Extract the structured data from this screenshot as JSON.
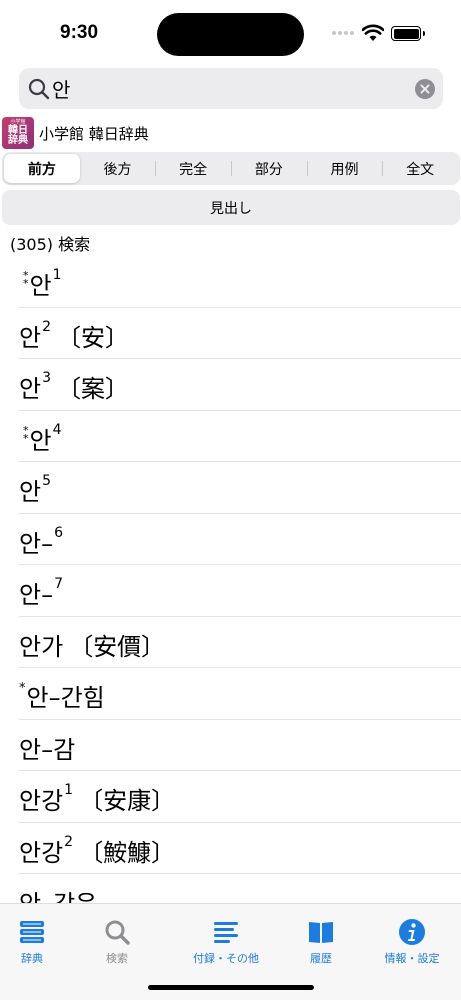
{
  "status_bar": {
    "time": "9:30"
  },
  "search": {
    "value": "안"
  },
  "dictionary": {
    "logo_lines": [
      "小学館",
      "韓日",
      "辞典"
    ],
    "title": "小学館 韓日辞典"
  },
  "search_modes": {
    "tabs": [
      "前方",
      "後方",
      "完全",
      "部分",
      "用例",
      "全文"
    ],
    "selected": "前方"
  },
  "field_button": "見出し",
  "result_count": "(305) 検索",
  "results": [
    {
      "mark": "**",
      "head": "안",
      "sup": "1",
      "hanja": ""
    },
    {
      "mark": "",
      "head": "안",
      "sup": "2",
      "hanja": "〔安〕"
    },
    {
      "mark": "",
      "head": "안",
      "sup": "3",
      "hanja": "〔案〕"
    },
    {
      "mark": "**",
      "head": "안",
      "sup": "4",
      "hanja": ""
    },
    {
      "mark": "",
      "head": "안",
      "sup": "5",
      "hanja": ""
    },
    {
      "mark": "",
      "head": "안–",
      "sup": "6",
      "hanja": ""
    },
    {
      "mark": "",
      "head": "안–",
      "sup": "7",
      "hanja": ""
    },
    {
      "mark": "",
      "head": "안가",
      "sup": "",
      "hanja": "〔安價〕"
    },
    {
      "mark": "*",
      "head": "안–간힘",
      "sup": "",
      "hanja": ""
    },
    {
      "mark": "",
      "head": "안–감",
      "sup": "",
      "hanja": ""
    },
    {
      "mark": "",
      "head": "안강",
      "sup": "1",
      "hanja": "〔安康〕"
    },
    {
      "mark": "",
      "head": "안강",
      "sup": "2",
      "hanja": "〔鮟鱇〕"
    },
    {
      "mark": "",
      "head": "안–강은",
      "sup": "",
      "hanja": ""
    }
  ],
  "tab_bar": {
    "items": [
      {
        "label": "辞典",
        "icon": "books-icon",
        "active": true
      },
      {
        "label": "検索",
        "icon": "search-icon",
        "active": false
      },
      {
        "label": "付録・その他",
        "icon": "list-icon",
        "active": true
      },
      {
        "label": "履歴",
        "icon": "book-icon",
        "active": true
      },
      {
        "label": "情報・設定",
        "icon": "info-icon",
        "active": true
      }
    ]
  },
  "colors": {
    "accent": "#1c7ce0",
    "inactive": "#8e8e93",
    "search_field_bg": "#ececef"
  }
}
